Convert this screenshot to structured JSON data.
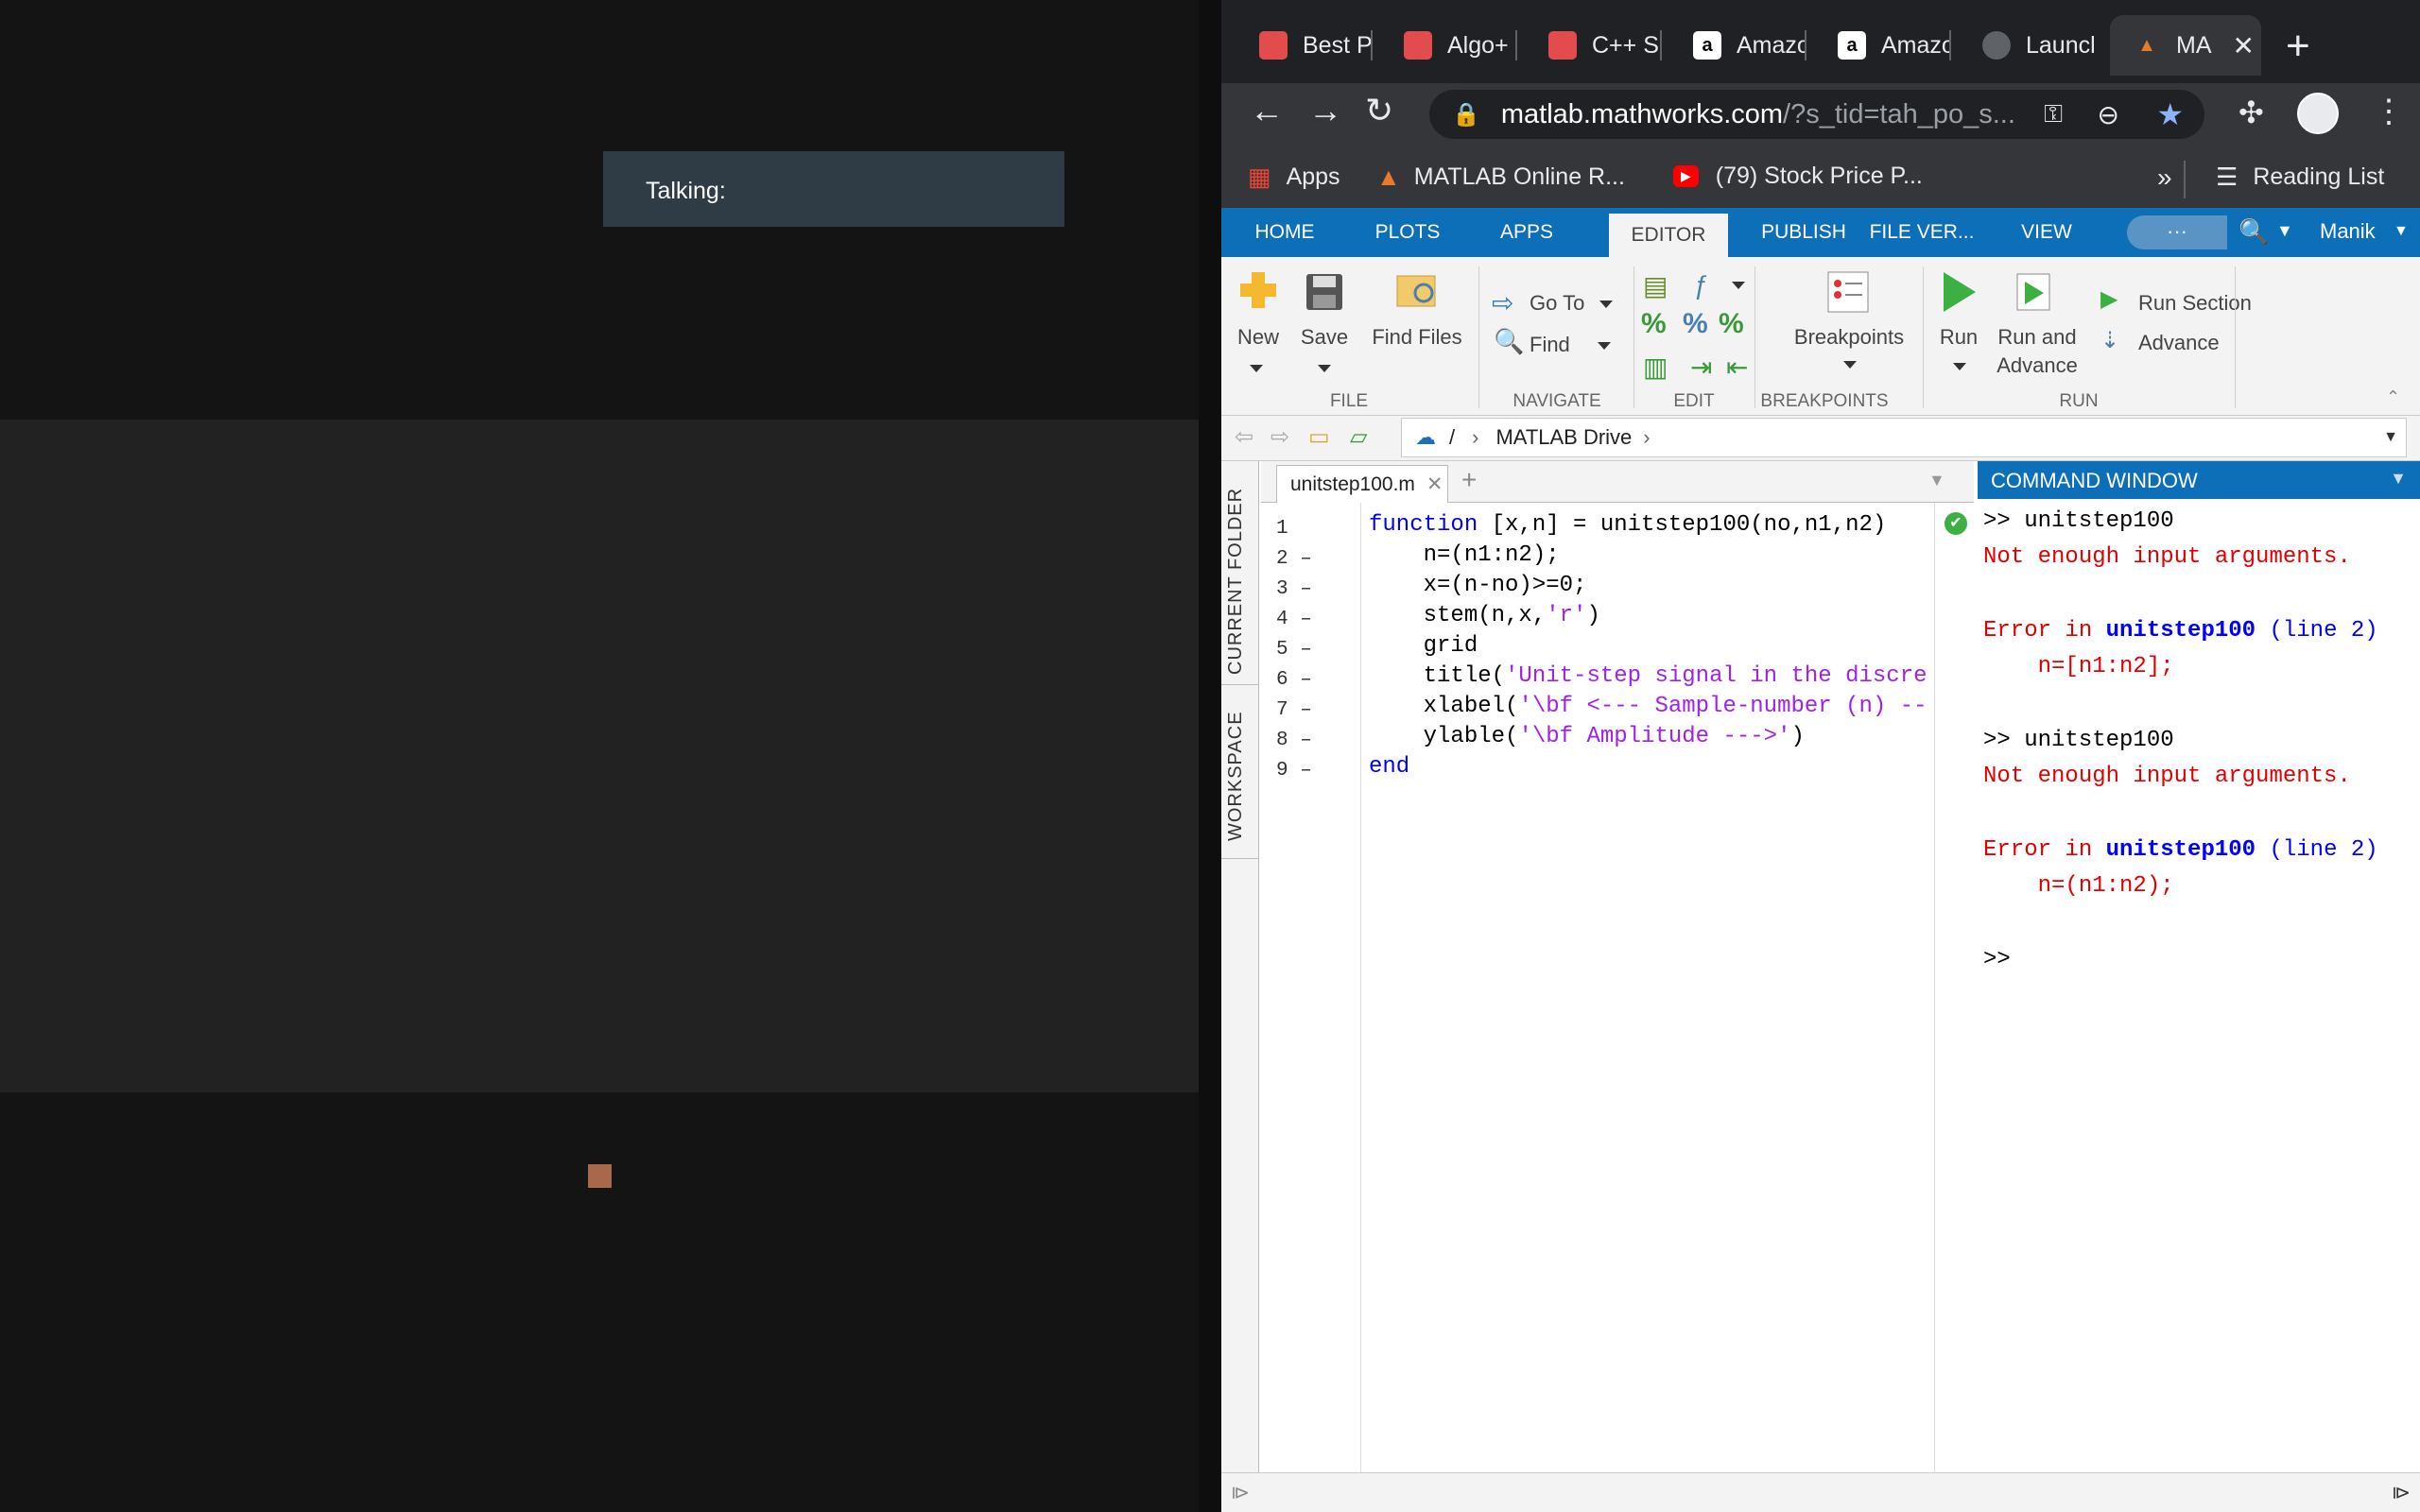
{
  "meeting": {
    "talking_label": "Talking:"
  },
  "browser": {
    "tabs": [
      {
        "title": "Best P",
        "icon": "cube-icon"
      },
      {
        "title": "Algo+",
        "icon": "cube-icon"
      },
      {
        "title": "C++ S",
        "icon": "cube-icon"
      },
      {
        "title": "Amazo",
        "icon": "amazon-icon"
      },
      {
        "title": "Amazo",
        "icon": "amazon-icon"
      },
      {
        "title": "Launcl",
        "icon": "globe-icon"
      },
      {
        "title": "MA",
        "icon": "matlab-icon"
      }
    ],
    "url_host": "matlab.mathworks.com",
    "url_path": "/?s_tid=tah_po_s...",
    "bookmarks": {
      "apps": "Apps",
      "matlab": "MATLAB Online R...",
      "youtube": "(79) Stock Price P...",
      "more": "»",
      "reading_list": "Reading List"
    },
    "avatar_initial": ""
  },
  "matlab": {
    "tabs": [
      "HOME",
      "PLOTS",
      "APPS",
      "EDITOR",
      "PUBLISH",
      "FILE VER...",
      "VIEW"
    ],
    "user": "Manik",
    "ribbon": {
      "new": "New",
      "save": "Save",
      "find_files": "Find Files",
      "go_to": "Go To",
      "find": "Find",
      "breakpoints": "Breakpoints",
      "run": "Run",
      "run_and_advance_1": "Run and",
      "run_and_advance_2": "Advance",
      "run_section": "Run Section",
      "advance": "Advance",
      "sections": {
        "file": "FILE",
        "navigate": "NAVIGATE",
        "edit": "EDIT",
        "breakpoints": "BREAKPOINTS",
        "run": "RUN"
      }
    },
    "address": {
      "root": "/",
      "folder": "MATLAB Drive"
    },
    "side_tabs": {
      "current_folder": "CURRENT FOLDER",
      "workspace": "WORKSPACE"
    },
    "editor": {
      "file_tab": "unitstep100.m",
      "line_numbers": [
        "1",
        "2 –",
        "3 –",
        "4 –",
        "5 –",
        "6 –",
        "7 –",
        "8 –",
        "9 –"
      ],
      "lines": [
        {
          "kw": "function",
          "rest": " [x,n] = unitstep100(no,n1,n2)",
          "str": "",
          "tail": ""
        },
        {
          "kw": "",
          "rest": "    n=(n1:n2);",
          "str": "",
          "tail": ""
        },
        {
          "kw": "",
          "rest": "    x=(n-no)>=0;",
          "str": "",
          "tail": ""
        },
        {
          "kw": "",
          "rest": "    stem(n,x,",
          "str": "'r'",
          "tail": ")"
        },
        {
          "kw": "",
          "rest": "    grid",
          "str": "",
          "tail": ""
        },
        {
          "kw": "",
          "rest": "    title(",
          "str": "'Unit-step signal in the discre",
          "tail": ""
        },
        {
          "kw": "",
          "rest": "    xlabel(",
          "str": "'\\bf <--- Sample-number (n) --",
          "tail": ""
        },
        {
          "kw": "",
          "rest": "    ylable(",
          "str": "'\\bf Amplitude --->'",
          "tail": ")"
        },
        {
          "kw": "end",
          "rest": "",
          "str": "",
          "tail": ""
        }
      ]
    },
    "command_window": {
      "title": "COMMAND WINDOW",
      "prompt1": ">> unitstep100",
      "err1": "Not enough input arguments.",
      "err_in": "Error in ",
      "fn": "unitstep100",
      "line_ref": " (line 2)",
      "code1": "    n=[n1:n2];",
      "prompt2": ">> unitstep100",
      "err2": "Not enough input arguments.",
      "code2": "    n=(n1:n2);",
      "prompt3": ">>"
    }
  },
  "colors": {
    "matlab_blue": "#0d6fb8",
    "error_red": "#e00000",
    "string_purple": "#a020f0",
    "keyword_blue": "#0000ff"
  }
}
